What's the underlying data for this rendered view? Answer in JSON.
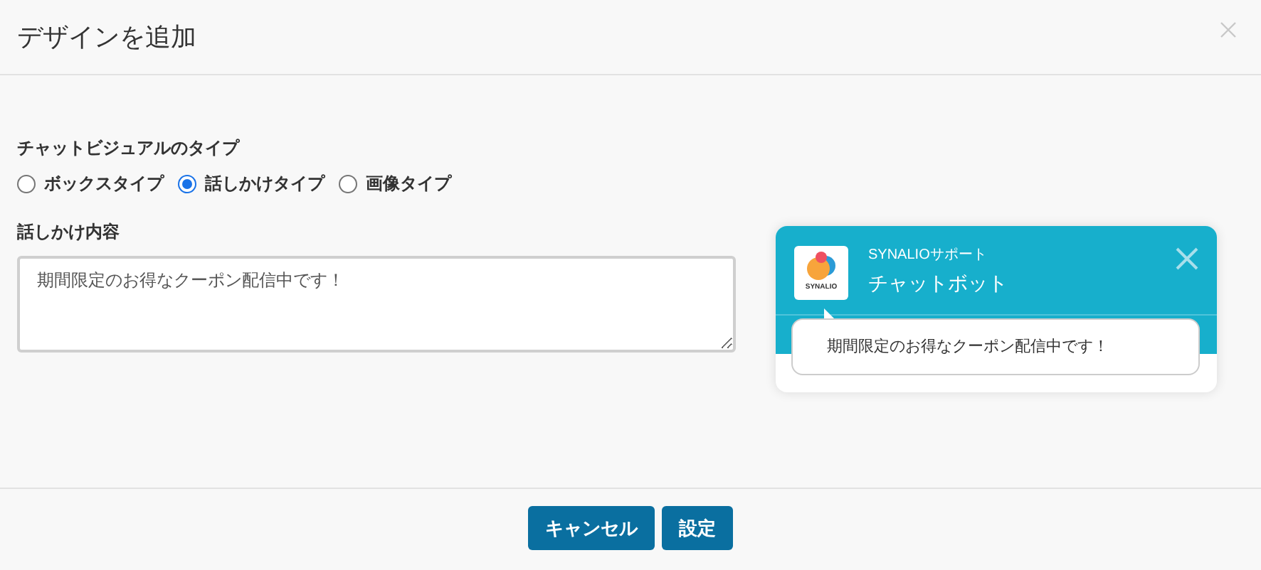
{
  "dialog": {
    "title": "デザインを追加"
  },
  "visual_type": {
    "label": "チャットビジュアルのタイプ",
    "options": [
      {
        "label": "ボックスタイプ",
        "selected": false
      },
      {
        "label": "話しかけタイプ",
        "selected": true
      },
      {
        "label": "画像タイプ",
        "selected": false
      }
    ]
  },
  "message": {
    "label": "話しかけ内容",
    "value": "期間限定のお得なクーポン配信中です！"
  },
  "preview": {
    "logo_text": "SYNALIO",
    "subtitle": "SYNALIOサポート",
    "title": "チャットボット",
    "bubble": "期間限定のお得なクーポン配信中です！"
  },
  "buttons": [
    "キャンセル",
    "設定"
  ]
}
